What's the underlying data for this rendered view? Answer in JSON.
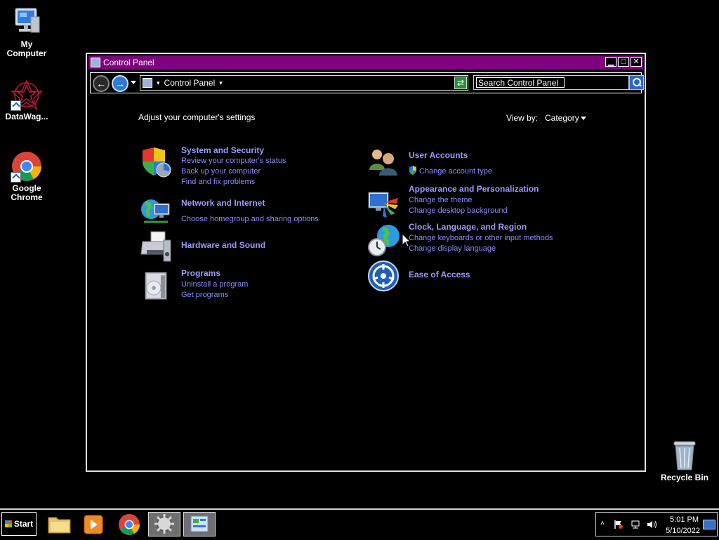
{
  "desktop": {
    "icons": [
      {
        "label": "My Computer"
      },
      {
        "label": "DataWag..."
      },
      {
        "label": "Google Chrome"
      },
      {
        "label": "Recycle Bin"
      }
    ]
  },
  "window": {
    "title": "Control Panel",
    "titlebar_color": "#800080",
    "address": {
      "crumb": "Control Panel"
    },
    "search": {
      "placeholder": "Search Control Panel"
    },
    "heading": "Adjust your computer's settings",
    "view_by_label": "View by:",
    "view_by_value": "Category",
    "link_color": "#8a8aff",
    "categories": [
      {
        "title": "System and Security",
        "icon": "shield-icon",
        "links": [
          "Review your computer's status",
          "Back up your computer",
          "Find and fix problems"
        ]
      },
      {
        "title": "Network and Internet",
        "icon": "globe-network-icon",
        "links": [
          "Choose homegroup and sharing options"
        ]
      },
      {
        "title": "Hardware and Sound",
        "icon": "printer-icon",
        "links": []
      },
      {
        "title": "Programs",
        "icon": "programs-icon",
        "links": [
          "Uninstall a program",
          "Get programs"
        ]
      },
      {
        "title": "User Accounts",
        "icon": "users-icon",
        "links": [
          "Change account type"
        ]
      },
      {
        "title": "Appearance and Personalization",
        "icon": "monitor-palette-icon",
        "links": [
          "Change the theme",
          "Change desktop background"
        ]
      },
      {
        "title": "Clock, Language, and Region",
        "icon": "clock-globe-icon",
        "links": [
          "Change keyboards or other input methods",
          "Change display language"
        ]
      },
      {
        "title": "Ease of Access",
        "icon": "ease-of-access-icon",
        "links": []
      }
    ]
  },
  "taskbar": {
    "start_label": "Start",
    "clock_time": "5:01 PM",
    "clock_date": "5/10/2022"
  }
}
